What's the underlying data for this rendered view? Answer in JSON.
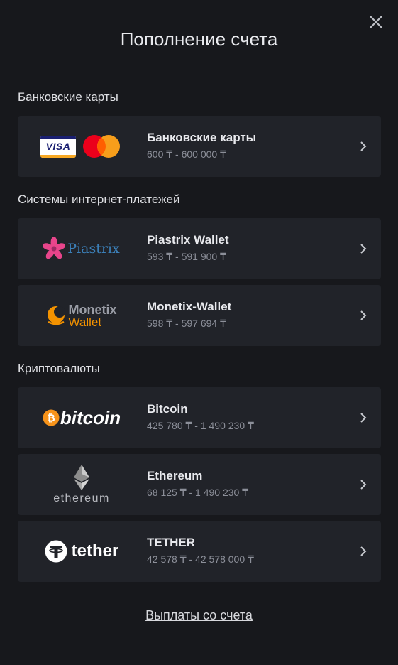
{
  "header": {
    "title": "Пополнение счета",
    "close_icon": "close-icon"
  },
  "sections": [
    {
      "title": "Банковские карты",
      "items": [
        {
          "name": "Банковские карты",
          "limits": "600 ₸ - 600 000 ₸",
          "logo_text": "VISA",
          "icon": "visa-mastercard-logo"
        }
      ]
    },
    {
      "title": "Системы интернет-платежей",
      "items": [
        {
          "name": "Piastrix Wallet",
          "limits": "593 ₸ - 591 900 ₸",
          "logo_text": "Piastrix",
          "icon": "piastrix-logo"
        },
        {
          "name": "Monetix-Wallet",
          "limits": "598 ₸ - 597 694 ₸",
          "logo_text_1": "Monetix",
          "logo_text_2": "Wallet",
          "icon": "monetix-logo"
        }
      ]
    },
    {
      "title": "Криптовалюты",
      "items": [
        {
          "name": "Bitcoin",
          "limits": "425 780 ₸ - 1 490 230 ₸",
          "logo_text": "bitcoin",
          "icon": "bitcoin-logo"
        },
        {
          "name": "Ethereum",
          "limits": "68 125 ₸ - 1 490 230 ₸",
          "logo_text": "ethereum",
          "icon": "ethereum-logo"
        },
        {
          "name": "TETHER",
          "limits": "42 578 ₸ - 42 578 000 ₸",
          "logo_text": "tether",
          "icon": "tether-logo"
        }
      ]
    }
  ],
  "footer": {
    "link": "Выплаты со счета"
  },
  "colors": {
    "background": "#17181c",
    "card": "#212329",
    "bitcoin": "#f7931a",
    "mastercard_red": "#eb001b",
    "mastercard_orange": "#f79e1b",
    "monetix_orange": "#f39200"
  }
}
